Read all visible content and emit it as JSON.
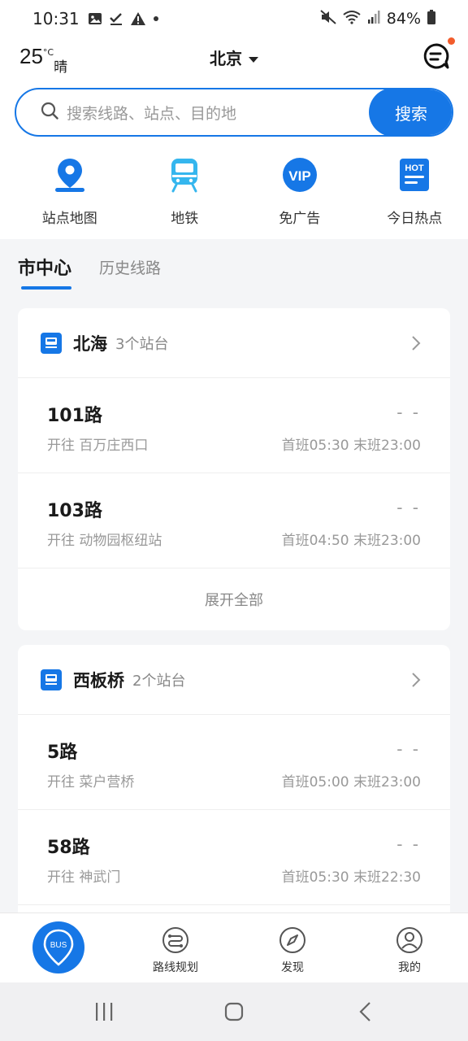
{
  "status_bar": {
    "time": "10:31",
    "battery": "84%",
    "icons": [
      "image-icon",
      "check-icon",
      "warning-icon",
      "dot-icon",
      "mute-icon",
      "wifi-icon",
      "signal-icon",
      "battery-icon"
    ]
  },
  "header": {
    "temperature": "25",
    "temp_unit": "°C",
    "weather": "晴",
    "city": "北京"
  },
  "search": {
    "placeholder": "搜索线路、站点、目的地",
    "button": "搜索"
  },
  "quick_actions": [
    {
      "label": "站点地图",
      "icon": "map-pin-icon"
    },
    {
      "label": "地铁",
      "icon": "subway-icon"
    },
    {
      "label": "免广告",
      "icon": "vip-icon"
    },
    {
      "label": "今日热点",
      "icon": "hot-icon"
    }
  ],
  "tabs": {
    "active": "市中心",
    "other": "历史线路"
  },
  "stations": [
    {
      "name": "北海",
      "count": "3个站台",
      "routes": [
        {
          "name": "101路",
          "status": "- -",
          "dest": "开往 百万庄西口",
          "schedule": "首班05:30 末班23:00"
        },
        {
          "name": "103路",
          "status": "- -",
          "dest": "开往 动物园枢纽站",
          "schedule": "首班04:50 末班23:00"
        }
      ],
      "expand": "展开全部"
    },
    {
      "name": "西板桥",
      "count": "2个站台",
      "routes": [
        {
          "name": "5路",
          "status": "- -",
          "dest": "开往 菜户营桥",
          "schedule": "首班05:00 末班23:00"
        },
        {
          "name": "58路",
          "status": "- -",
          "dest": "开往 神武门",
          "schedule": "首班05:30 末班22:30"
        }
      ]
    }
  ],
  "bottom_nav": {
    "bus": "BUS",
    "route_plan": "路线规划",
    "discover": "发现",
    "mine": "我的"
  },
  "colors": {
    "accent": "#1677e6",
    "notification_dot": "#f25c2b"
  }
}
